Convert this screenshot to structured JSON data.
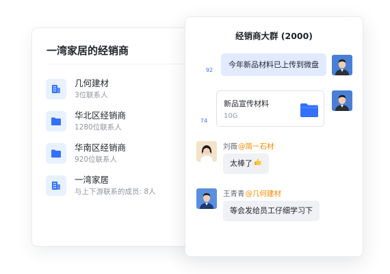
{
  "dealer_list": {
    "title": "一湾家居的经销商",
    "items": [
      {
        "name": "几何建材",
        "subtitle": "3位联系人",
        "icon": "building-icon"
      },
      {
        "name": "华北区经销商",
        "subtitle": "1280位联系人",
        "icon": "folder-icon"
      },
      {
        "name": "华南区经销商",
        "subtitle": "920位联系人",
        "icon": "folder-icon"
      },
      {
        "name": "一湾家居",
        "subtitle": "与上下游联系的成员: 8人",
        "icon": "building-icon"
      }
    ]
  },
  "chat": {
    "title": "经销商大群 (2000)",
    "messages": [
      {
        "type": "text",
        "text": "今年新品材料已上传到微盘",
        "read_count": "92"
      },
      {
        "type": "file",
        "file_name": "新品宣传材料",
        "file_size": "10G",
        "read_count": "74"
      },
      {
        "type": "text",
        "sender": "刘薇",
        "mention": "@简一石材",
        "text": "太棒了"
      },
      {
        "type": "text",
        "sender": "王青青",
        "mention": "@几何建材",
        "text": "等会发给员工仔细学习下"
      }
    ]
  },
  "colors": {
    "accent_blue": "#3370ff",
    "bubble_blue": "#e1eaff",
    "bubble_gray": "#f0f1f5",
    "mention_orange": "#ff8800"
  }
}
